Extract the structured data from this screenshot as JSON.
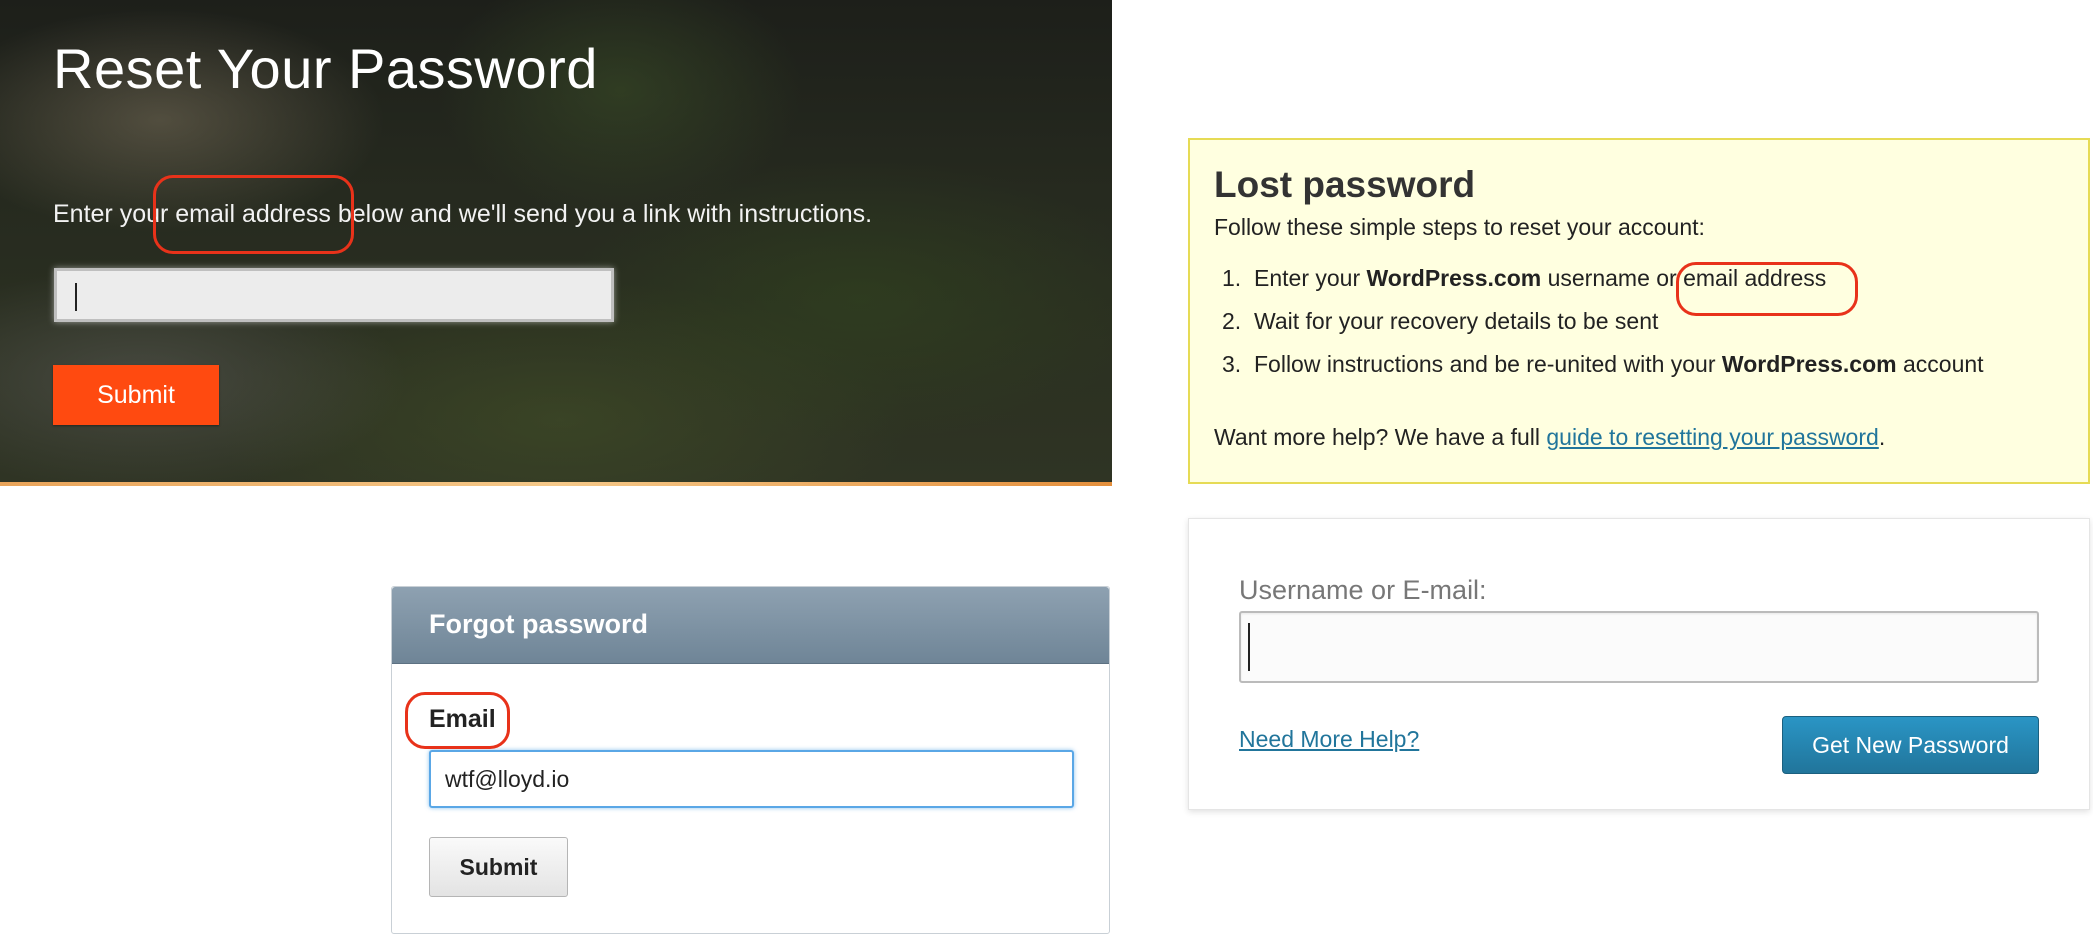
{
  "reset_panel": {
    "title": "Reset Your Password",
    "description": "Enter your email address below and we'll send you a link with instructions.",
    "input_value": "",
    "submit_label": "Submit",
    "accent_color": "#ff4a10"
  },
  "forgot_panel": {
    "title": "Forgot password",
    "email_label": "Email",
    "email_value": "wtf@lloyd.io",
    "submit_label": "Submit",
    "header_color": "#7b90a2"
  },
  "lost_panel": {
    "title": "Lost password",
    "intro": "Follow these simple steps to reset your account:",
    "steps": [
      {
        "num": "1.",
        "pre": "Enter your ",
        "bold": "WordPress.com",
        "post": " username or email address"
      },
      {
        "num": "2.",
        "text": "Wait for your recovery details to be sent"
      },
      {
        "num": "3.",
        "pre": "Follow instructions and be re-united with your ",
        "bold": "WordPress.com",
        "post": " account"
      }
    ],
    "help_prefix": "Want more help? We have a full ",
    "help_link": "guide to resetting your password",
    "help_suffix": ".",
    "background_color": "#ffffe0",
    "border_color": "#e6db55"
  },
  "wp_form": {
    "field_label": "Username or E-mail:",
    "field_value": "",
    "help_link": "Need More Help?",
    "submit_label": "Get New Password",
    "link_color": "#21759b"
  },
  "annotations": {
    "color": "#e8321a",
    "highlighted": [
      "email address",
      "Email",
      "email address"
    ]
  }
}
